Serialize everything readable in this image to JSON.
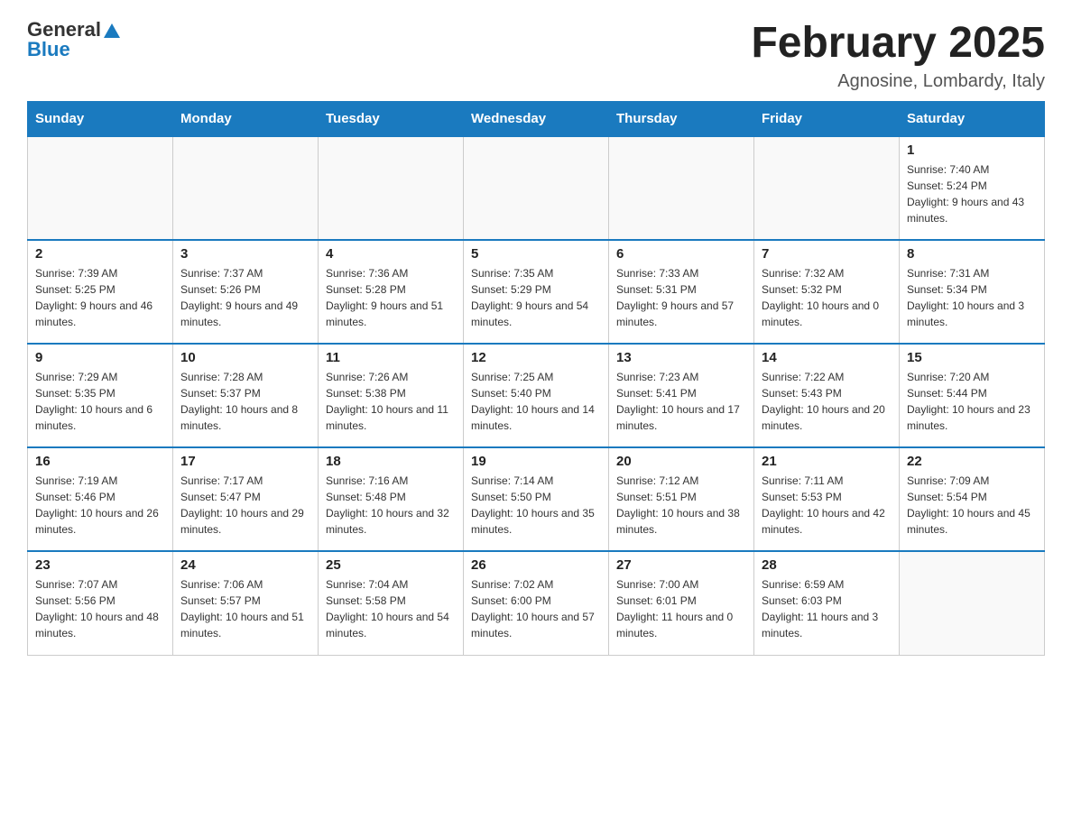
{
  "logo": {
    "general": "General",
    "triangle": "▲",
    "blue": "Blue"
  },
  "header": {
    "title": "February 2025",
    "location": "Agnosine, Lombardy, Italy"
  },
  "columns": [
    "Sunday",
    "Monday",
    "Tuesday",
    "Wednesday",
    "Thursday",
    "Friday",
    "Saturday"
  ],
  "weeks": [
    [
      {
        "day": "",
        "info": ""
      },
      {
        "day": "",
        "info": ""
      },
      {
        "day": "",
        "info": ""
      },
      {
        "day": "",
        "info": ""
      },
      {
        "day": "",
        "info": ""
      },
      {
        "day": "",
        "info": ""
      },
      {
        "day": "1",
        "info": "Sunrise: 7:40 AM\nSunset: 5:24 PM\nDaylight: 9 hours and 43 minutes."
      }
    ],
    [
      {
        "day": "2",
        "info": "Sunrise: 7:39 AM\nSunset: 5:25 PM\nDaylight: 9 hours and 46 minutes."
      },
      {
        "day": "3",
        "info": "Sunrise: 7:37 AM\nSunset: 5:26 PM\nDaylight: 9 hours and 49 minutes."
      },
      {
        "day": "4",
        "info": "Sunrise: 7:36 AM\nSunset: 5:28 PM\nDaylight: 9 hours and 51 minutes."
      },
      {
        "day": "5",
        "info": "Sunrise: 7:35 AM\nSunset: 5:29 PM\nDaylight: 9 hours and 54 minutes."
      },
      {
        "day": "6",
        "info": "Sunrise: 7:33 AM\nSunset: 5:31 PM\nDaylight: 9 hours and 57 minutes."
      },
      {
        "day": "7",
        "info": "Sunrise: 7:32 AM\nSunset: 5:32 PM\nDaylight: 10 hours and 0 minutes."
      },
      {
        "day": "8",
        "info": "Sunrise: 7:31 AM\nSunset: 5:34 PM\nDaylight: 10 hours and 3 minutes."
      }
    ],
    [
      {
        "day": "9",
        "info": "Sunrise: 7:29 AM\nSunset: 5:35 PM\nDaylight: 10 hours and 6 minutes."
      },
      {
        "day": "10",
        "info": "Sunrise: 7:28 AM\nSunset: 5:37 PM\nDaylight: 10 hours and 8 minutes."
      },
      {
        "day": "11",
        "info": "Sunrise: 7:26 AM\nSunset: 5:38 PM\nDaylight: 10 hours and 11 minutes."
      },
      {
        "day": "12",
        "info": "Sunrise: 7:25 AM\nSunset: 5:40 PM\nDaylight: 10 hours and 14 minutes."
      },
      {
        "day": "13",
        "info": "Sunrise: 7:23 AM\nSunset: 5:41 PM\nDaylight: 10 hours and 17 minutes."
      },
      {
        "day": "14",
        "info": "Sunrise: 7:22 AM\nSunset: 5:43 PM\nDaylight: 10 hours and 20 minutes."
      },
      {
        "day": "15",
        "info": "Sunrise: 7:20 AM\nSunset: 5:44 PM\nDaylight: 10 hours and 23 minutes."
      }
    ],
    [
      {
        "day": "16",
        "info": "Sunrise: 7:19 AM\nSunset: 5:46 PM\nDaylight: 10 hours and 26 minutes."
      },
      {
        "day": "17",
        "info": "Sunrise: 7:17 AM\nSunset: 5:47 PM\nDaylight: 10 hours and 29 minutes."
      },
      {
        "day": "18",
        "info": "Sunrise: 7:16 AM\nSunset: 5:48 PM\nDaylight: 10 hours and 32 minutes."
      },
      {
        "day": "19",
        "info": "Sunrise: 7:14 AM\nSunset: 5:50 PM\nDaylight: 10 hours and 35 minutes."
      },
      {
        "day": "20",
        "info": "Sunrise: 7:12 AM\nSunset: 5:51 PM\nDaylight: 10 hours and 38 minutes."
      },
      {
        "day": "21",
        "info": "Sunrise: 7:11 AM\nSunset: 5:53 PM\nDaylight: 10 hours and 42 minutes."
      },
      {
        "day": "22",
        "info": "Sunrise: 7:09 AM\nSunset: 5:54 PM\nDaylight: 10 hours and 45 minutes."
      }
    ],
    [
      {
        "day": "23",
        "info": "Sunrise: 7:07 AM\nSunset: 5:56 PM\nDaylight: 10 hours and 48 minutes."
      },
      {
        "day": "24",
        "info": "Sunrise: 7:06 AM\nSunset: 5:57 PM\nDaylight: 10 hours and 51 minutes."
      },
      {
        "day": "25",
        "info": "Sunrise: 7:04 AM\nSunset: 5:58 PM\nDaylight: 10 hours and 54 minutes."
      },
      {
        "day": "26",
        "info": "Sunrise: 7:02 AM\nSunset: 6:00 PM\nDaylight: 10 hours and 57 minutes."
      },
      {
        "day": "27",
        "info": "Sunrise: 7:00 AM\nSunset: 6:01 PM\nDaylight: 11 hours and 0 minutes."
      },
      {
        "day": "28",
        "info": "Sunrise: 6:59 AM\nSunset: 6:03 PM\nDaylight: 11 hours and 3 minutes."
      },
      {
        "day": "",
        "info": ""
      }
    ]
  ]
}
